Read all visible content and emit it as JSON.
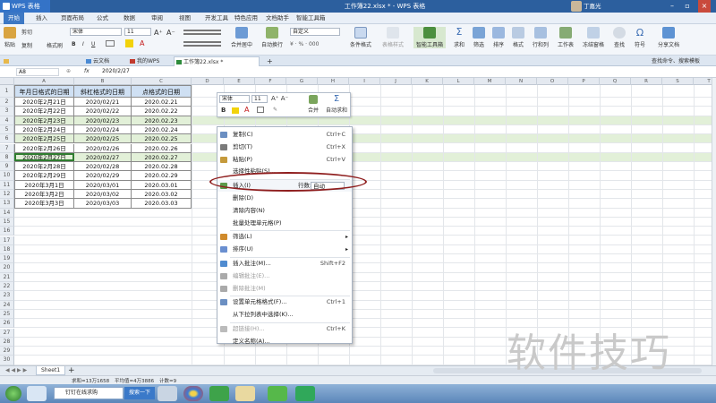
{
  "window": {
    "app_button": "WPS 表格",
    "title": "工作簿22.xlsx * - WPS 表格",
    "user": "丁嘉光"
  },
  "menu": [
    "开始",
    "插入",
    "页面布局",
    "公式",
    "数据",
    "审阅",
    "视图",
    "开发工具",
    "特色应用",
    "文档助手",
    "智能工具箱"
  ],
  "toolbar": {
    "cut": "剪切",
    "paste": "粘贴",
    "copy": "复制",
    "format_painter": "格式刷",
    "font": "宋体",
    "font_size": "11",
    "merge": "合并居中",
    "wrap": "自动换行",
    "number_format": "自定义",
    "cond_format": "条件格式",
    "table_style": "表格样式",
    "smart_toolbox": "智能工具箱",
    "sum": "求和",
    "filter": "筛选",
    "sort": "排序",
    "format": "格式",
    "rowcol": "行和列",
    "worksheet": "工作表",
    "freeze": "冻结窗格",
    "find": "查找",
    "symbol": "符号",
    "share": "分享文档"
  },
  "doc_tabs": [
    "云文档",
    "我的WPS",
    "工作簿22.xlsx *"
  ],
  "search_hint": "查找命令、搜索模板",
  "formula_bar": {
    "name_box": "A8",
    "fx": "fx",
    "value": "2020/2/27"
  },
  "columns": [
    "A",
    "B",
    "C",
    "D",
    "E",
    "F",
    "G",
    "H",
    "I",
    "J",
    "K",
    "L",
    "M",
    "N",
    "O",
    "P",
    "Q",
    "R",
    "S",
    "T",
    "U"
  ],
  "rows": [
    "1",
    "2",
    "3",
    "4",
    "5",
    "6",
    "7",
    "8",
    "9",
    "10",
    "11",
    "12",
    "13",
    "14",
    "15",
    "16",
    "17",
    "18",
    "19",
    "20",
    "21",
    "22",
    "23",
    "24",
    "25",
    "26",
    "27",
    "28",
    "29",
    "30",
    "31"
  ],
  "table": {
    "headers": [
      "年月日格式的日期",
      "斜杠格式的日期",
      "点格式的日期"
    ],
    "data": [
      [
        "2020年2月21日",
        "2020/02/21",
        "2020.02.21"
      ],
      [
        "2020年2月22日",
        "2020/02/22",
        "2020.02.22"
      ],
      [
        "2020年2月23日",
        "2020/02/23",
        "2020.02.23"
      ],
      [
        "2020年2月24日",
        "2020/02/24",
        "2020.02.24"
      ],
      [
        "2020年2月25日",
        "2020/02/25",
        "2020.02.25"
      ],
      [
        "2020年2月26日",
        "2020/02/26",
        "2020.02.26"
      ],
      [
        "2020年2月27日",
        "2020/02/27",
        "2020.02.27"
      ],
      [
        "2020年2月28日",
        "2020/02/28",
        "2020.02.28"
      ],
      [
        "2020年2月29日",
        "2020/02/29",
        "2020.02.29"
      ],
      [
        "2020年3月1日",
        "2020/03/01",
        "2020.03.01"
      ],
      [
        "2020年3月2日",
        "2020/03/02",
        "2020.03.02"
      ],
      [
        "2020年3月3日",
        "2020/03/03",
        "2020.03.03"
      ]
    ]
  },
  "mini_toolbar": {
    "font": "宋体",
    "size": "11",
    "merge": "合并",
    "autosum": "自动求和"
  },
  "context_menu": [
    {
      "label": "复制(C)",
      "shortcut": "Ctrl+C",
      "disabled": false
    },
    {
      "label": "剪切(T)",
      "shortcut": "Ctrl+X",
      "disabled": false
    },
    {
      "label": "粘贴(P)",
      "shortcut": "Ctrl+V",
      "disabled": false
    },
    {
      "label": "选择性粘贴(S)...",
      "shortcut": "",
      "disabled": false
    },
    {
      "label": "插入(I)",
      "shortcut": "",
      "disabled": false
    },
    {
      "label": "删除(D)",
      "shortcut": "",
      "disabled": false
    },
    {
      "label": "清除内容(N)",
      "shortcut": "",
      "disabled": false
    },
    {
      "label": "批量处理单元格(P)",
      "shortcut": "",
      "disabled": false
    },
    {
      "label": "筛选(L)",
      "shortcut": "",
      "disabled": false
    },
    {
      "label": "排序(U)",
      "shortcut": "",
      "disabled": false
    },
    {
      "label": "插入批注(M)...",
      "shortcut": "Shift+F2",
      "disabled": false
    },
    {
      "label": "编辑批注(E)...",
      "shortcut": "",
      "disabled": true
    },
    {
      "label": "删除批注(M)",
      "shortcut": "",
      "disabled": true
    },
    {
      "label": "设置单元格格式(F)...",
      "shortcut": "Ctrl+1",
      "disabled": false
    },
    {
      "label": "从下拉列表中选择(K)...",
      "shortcut": "",
      "disabled": false
    },
    {
      "label": "超链接(H)...",
      "shortcut": "Ctrl+K",
      "disabled": true
    },
    {
      "label": "定义名称(A)...",
      "shortcut": "",
      "disabled": false
    }
  ],
  "insert_rows": {
    "label": "行数:",
    "value": "自动"
  },
  "sheet_tab": "Sheet1",
  "status": {
    "sum": "求和=13万1658",
    "avg": "平均值=4万3886",
    "count": "计数=9"
  },
  "taskbar": {
    "search_placeholder": "钉钉在线求购",
    "search_button": "搜索一下"
  },
  "watermark": "软件技巧",
  "colors": {
    "accent": "#3d78c4",
    "highlight_row": "#e2f0d8",
    "header_fill": "#cfe0f3",
    "oval": "#8f1e1e"
  }
}
